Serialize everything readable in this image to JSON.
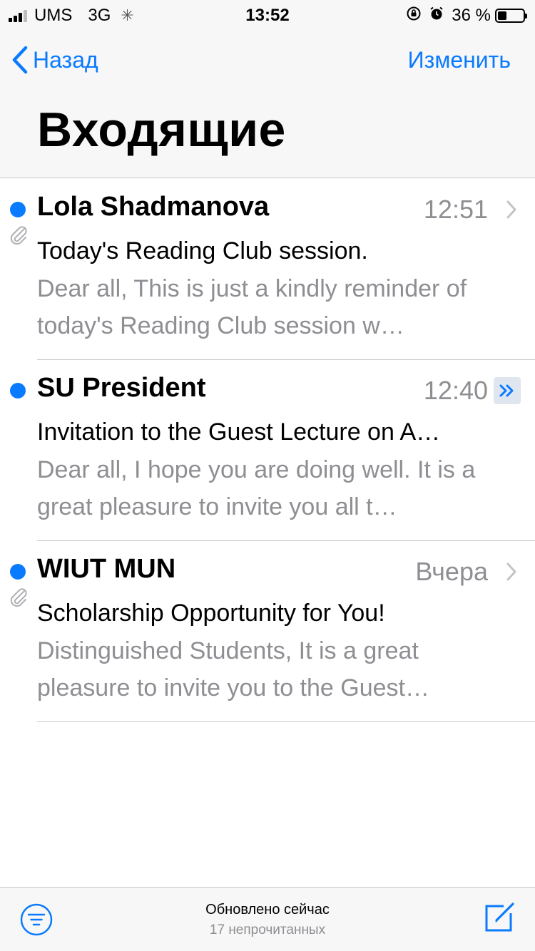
{
  "status_bar": {
    "carrier": "UMS",
    "network": "3G",
    "time": "13:52",
    "battery": "36 %",
    "battery_level": 0.36
  },
  "nav": {
    "back_label": "Назад",
    "edit_label": "Изменить",
    "title": "Входящие"
  },
  "mails": [
    {
      "sender": "Lola Shadmanova",
      "time": "12:51",
      "subject": "Today's Reading Club session.",
      "preview": "Dear all, This is just a kindly reminder of today's Reading Club session w…"
    },
    {
      "sender": "SU President",
      "time": "12:40",
      "subject": "Invitation to the Guest Lecture on A…",
      "preview": "Dear all, I hope you are doing well. It is a great pleasure to invite you all t…"
    },
    {
      "sender": "WIUT MUN",
      "time": "Вчера",
      "subject": "Scholarship Opportunity for You!",
      "preview": "Distinguished Students, It is a great pleasure to invite you to the Guest…"
    }
  ],
  "toolbar": {
    "updated": "Обновлено сейчас",
    "unread": "17 непрочитанных"
  },
  "colors": {
    "accent": "#0a7aff",
    "secondary_text": "#8e8e93",
    "separator": "#c8c7cc",
    "bar_background": "#f7f7f7"
  }
}
